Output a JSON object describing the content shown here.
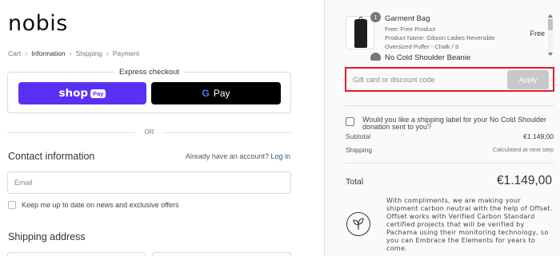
{
  "brand": {
    "logo": "nobis"
  },
  "breadcrumb": {
    "items": [
      "Cart",
      "Information",
      "Shipping",
      "Payment"
    ],
    "current": "Information",
    "separator": "›"
  },
  "express": {
    "title": "Express checkout",
    "shop_pay": {
      "word": "shop",
      "badge": "Pay"
    },
    "google_pay": {
      "g": "G",
      "label": "Pay"
    }
  },
  "divider_text": "OR",
  "contact": {
    "title": "Contact information",
    "account_prompt": "Already have an account?",
    "login_label": "Log in",
    "email_placeholder": "Email",
    "newsletter_label": "Keep me up to date on news and exclusive offers"
  },
  "shipping": {
    "title": "Shipping address"
  },
  "order": {
    "items": [
      {
        "qty": "1",
        "name": "Garment Bag",
        "lines": [
          "Free: Free Product",
          "Product Name: Gibson Ladies Reversible",
          "Oversized Puffer - Chalk / S"
        ],
        "price": "Free"
      },
      {
        "name": "No Cold Shoulder Beanie"
      }
    ],
    "discount": {
      "placeholder": "Gift card or discount code",
      "apply_label": "Apply"
    },
    "gift_question": "Would you like a shipping label for your No Cold Shoulder donation sent to you?",
    "subtotal_label": "Subtotal",
    "subtotal_value": "€1.149,00",
    "shipping_label": "Shipping",
    "shipping_value": "Calculated at next step",
    "total_label": "Total",
    "total_value": "€1.149,00",
    "offset_text": "With compliments, we are making your shipment carbon neutral with the help of Offset. Offset works with Verified Carbon Standard certified projects that will be verified by Pachama using their monitoring technology, so you can Embrace the Elements for years to come."
  },
  "colors": {
    "shop_pay": "#5a31f4",
    "highlight": "#e01b24",
    "link": "#2c5282"
  }
}
